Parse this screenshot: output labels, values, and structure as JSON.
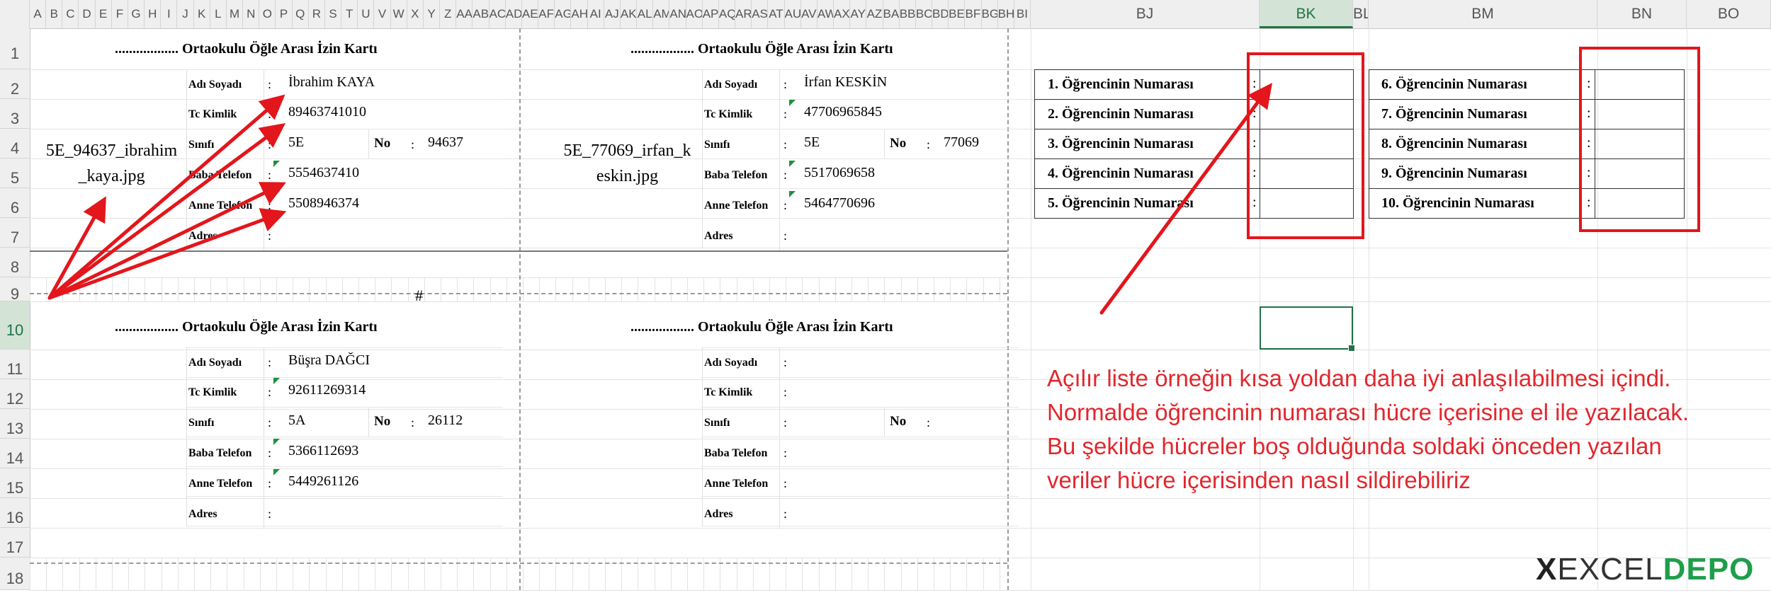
{
  "column_headers": [
    "A",
    "B",
    "C",
    "D",
    "E",
    "F",
    "G",
    "H",
    "I",
    "J",
    "K",
    "L",
    "M",
    "N",
    "O",
    "P",
    "Q",
    "R",
    "S",
    "T",
    "U",
    "V",
    "W",
    "X",
    "Y",
    "Z",
    "AA",
    "AB",
    "AC",
    "AD",
    "AE",
    "AF",
    "AG",
    "AH",
    "AI",
    "AJ",
    "AK",
    "AL",
    "AM",
    "AN",
    "AO",
    "AP",
    "AQ",
    "AR",
    "AS",
    "AT",
    "AU",
    "AV",
    "AW",
    "AX",
    "AY",
    "AZ",
    "BA",
    "BB",
    "BC",
    "BD",
    "BE",
    "BF",
    "BG",
    "BH",
    "BI"
  ],
  "right_headers": {
    "bj": "BJ",
    "bk": "BK",
    "bl": "BL",
    "bm": "BM",
    "bn": "BN",
    "bo": "BO"
  },
  "row_numbers": [
    "1",
    "2",
    "3",
    "4",
    "5",
    "6",
    "7",
    "8",
    "9",
    "10",
    "11",
    "12",
    "13",
    "14",
    "15",
    "16",
    "17",
    "18"
  ],
  "card_title": ".................. Ortaokulu Öğle Arası İzin Kartı",
  "labels": {
    "name": "Adı Soyadı",
    "tc": "Tc Kimlik",
    "class": "Sınıfı",
    "no": "No",
    "father": "Baba Telefon",
    "mother": "Anne Telefon",
    "address": "Adres",
    "colon": ":"
  },
  "cards": [
    {
      "photo": "5E_94637_ibrahim_kaya.jpg",
      "photo_l1": "5E_94637_ibrahim",
      "photo_l2": "_kaya.jpg",
      "name": "İbrahim KAYA",
      "tc": "89463741010",
      "class": "5E",
      "no": "94637",
      "father": "5554637410",
      "mother": "5508946374"
    },
    {
      "photo": "5E_77069_irfan_keskin.jpg",
      "photo_l1": "5E_77069_irfan_k",
      "photo_l2": "eskin.jpg",
      "name": "İrfan KESKİN",
      "tc": "47706965845",
      "class": "5E",
      "no": "77069",
      "father": "5517069658",
      "mother": "5464770696"
    },
    {
      "photo": "",
      "photo_l1": "",
      "photo_l2": "",
      "name": "Büşra DAĞCI",
      "tc": "92611269314",
      "class": "5A",
      "no": "26112",
      "father": "5366112693",
      "mother": "5449261126"
    },
    {
      "photo": "",
      "photo_l1": "",
      "photo_l2": "",
      "name": "",
      "tc": "",
      "class": "",
      "no": "",
      "father": "",
      "mother": ""
    }
  ],
  "hash_mark": "#",
  "student_number_labels": [
    "1. Öğrencinin Numarası",
    "2. Öğrencinin Numarası",
    "3. Öğrencinin Numarası",
    "4. Öğrencinin Numarası",
    "5. Öğrencinin Numarası",
    "6. Öğrencinin Numarası",
    "7. Öğrencinin Numarası",
    "8. Öğrencinin Numarası",
    "9. Öğrencinin Numarası",
    "10. Öğrencinin Numarası"
  ],
  "note_lines": [
    "Açılır liste örneğin kısa yoldan daha iyi anlaşılabilmesi içindi.",
    "Normalde öğrencinin numarası hücre içerisine el ile yazılacak.",
    "Bu şekilde hücreler boş olduğunda soldaki önceden yazılan",
    "veriler hücre içerisinden nasıl sildirebiliriz"
  ],
  "logo": {
    "prefix": "X",
    "part1": "EXCEL",
    "part2": "DEPO"
  },
  "colors": {
    "accent_red": "#e3161c",
    "note_red": "#e0282e",
    "excel_green": "#217346",
    "logo_green": "#1e9e4a"
  }
}
